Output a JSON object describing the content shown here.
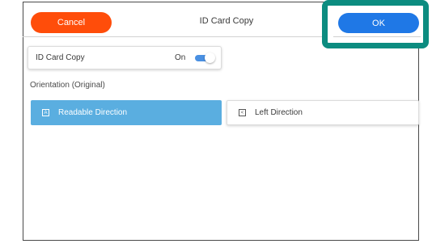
{
  "header": {
    "cancel_label": "Cancel",
    "title": "ID Card Copy",
    "ok_label": "OK"
  },
  "id_card_copy_setting": {
    "label": "ID Card Copy",
    "state": "On",
    "enabled": true
  },
  "orientation": {
    "section_label": "Orientation (Original)",
    "options": [
      {
        "label": "Readable Direction",
        "icon": "document-upright-icon",
        "icon_glyph": "A",
        "selected": true
      },
      {
        "label": "Left Direction",
        "icon": "document-rotated-left-icon",
        "icon_glyph": "<",
        "selected": false
      }
    ]
  },
  "colors": {
    "cancel": "#ff4d0a",
    "ok": "#1f78e6",
    "selected_option": "#5aaee0",
    "highlight_frame": "#0c8c80",
    "toggle_on": "#4a90e2"
  }
}
